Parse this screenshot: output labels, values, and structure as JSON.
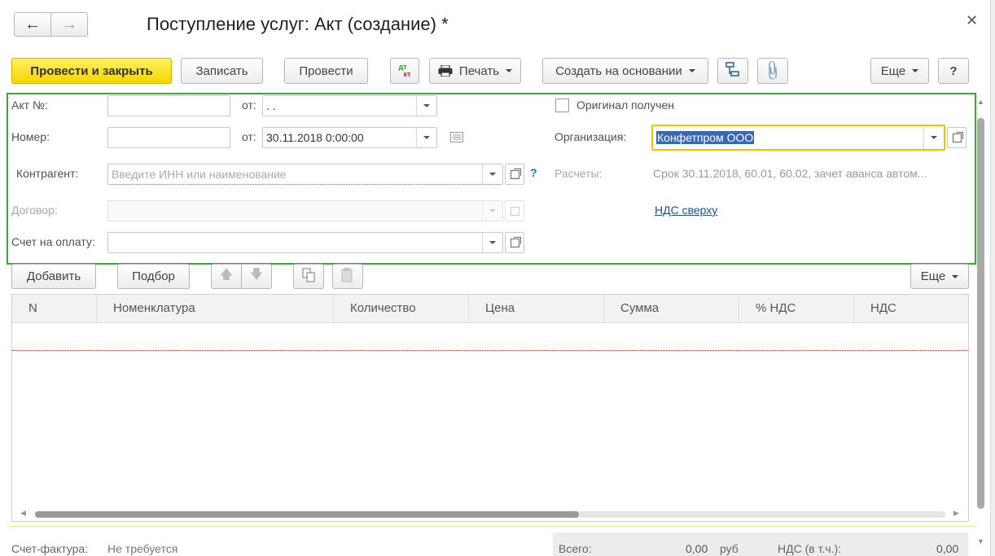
{
  "title": "Поступление услуг: Акт (создание) *",
  "toolbar": {
    "post_close": "Провести и закрыть",
    "save": "Записать",
    "post": "Провести",
    "dtkt_top": "дт",
    "dtkt_bottom": "кт",
    "print": "Печать",
    "create_based": "Создать на основании",
    "more": "Еще",
    "help": "?"
  },
  "form": {
    "act_no_label": "Акт №:",
    "act_no_value": "",
    "from_label": "от:",
    "act_date_value": " .  .",
    "number_label": "Номер:",
    "number_value": "",
    "from2_label": "от:",
    "number_date_value": "30.11.2018  0:00:00",
    "contractor_label": "Контрагент:",
    "contractor_placeholder": "Введите ИНН или наименование",
    "contractor_help": "?",
    "contract_label": "Договор:",
    "invoice_label": "Счет на оплату:",
    "original_label": "Оригинал получен",
    "org_label": "Организация:",
    "org_value": "Конфетпром ООО",
    "settlements_label": "Расчеты:",
    "settlements_value": "Срок 30.11.2018, 60.01, 60.02, зачет аванса автом...",
    "vat_link": "НДС сверху"
  },
  "table_toolbar": {
    "add": "Добавить",
    "pick": "Подбор",
    "more": "Еще"
  },
  "table": {
    "columns": [
      "N",
      "Номенклатура",
      "Количество",
      "Цена",
      "Сумма",
      "% НДС",
      "НДС"
    ]
  },
  "footer": {
    "invoice_label": "Счет-фактура:",
    "invoice_value": "Не требуется",
    "total_label": "Всего:",
    "total_value": "0,00",
    "currency": "руб",
    "vat_label": "НДС (в т.ч.):",
    "vat_value": "0,00"
  },
  "colors": {
    "primary_button": "#f5d500",
    "group_border": "#3aa835",
    "org_focus_border": "#f2c200",
    "link": "#1a4f9c"
  }
}
